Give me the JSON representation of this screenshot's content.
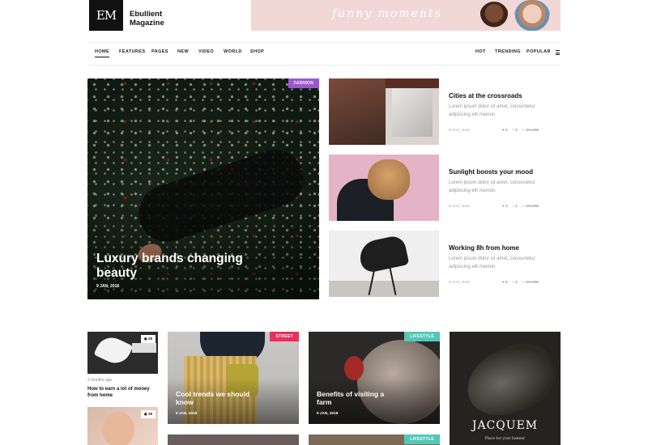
{
  "logo": {
    "mark": "EM",
    "line1": "Ebullient",
    "line2": "Magazine"
  },
  "banner": {
    "text": "funny moments"
  },
  "nav": {
    "left": [
      "HOME",
      "FEATURES",
      "PAGES",
      "NEW",
      "VIDEO",
      "WORLD",
      "SHOP"
    ],
    "right": [
      "HOT",
      "TRENDING",
      "POPULAR"
    ],
    "menu_icon": "hamburger-icon"
  },
  "hero": {
    "tag": "FASHION",
    "title": "Luxury brands changing beauty",
    "date": "9 JAN, 2018"
  },
  "side": [
    {
      "title": "Cities at the crossroads",
      "excerpt": "Lorem ipsum dolor sit amet, consectetur adipiscing elit meinon.",
      "date": "9 JAN, 2018",
      "likes": "0",
      "comments": "3",
      "share": "SHARE"
    },
    {
      "title": "Sunlight boosts your mood",
      "excerpt": "Lorem ipsum dolor sit amet, consectetur adipiscing elit meinon.",
      "date": "8 JAN, 2018",
      "likes": "3",
      "comments": "3",
      "share": "SHARE"
    },
    {
      "title": "Working 8h from home",
      "excerpt": "Lorem ipsum dolor sit amet, consectetur adipiscing elit meinon.",
      "date": "9 JAN, 2018",
      "likes": "5",
      "comments": "3",
      "share": "SHARE"
    }
  ],
  "small_post": {
    "views": "28",
    "ago": "2 months ago",
    "title": "How to earn a lot of money from home",
    "views2": "38"
  },
  "cards": [
    {
      "tag": "STREET",
      "title": "Cool trends we should know",
      "date": "9 JAN, 2018"
    },
    {
      "tag": "LIFESTYLE",
      "title": "Benefits of visiting a farm",
      "date": "9 JAN, 2018"
    }
  ],
  "ad": {
    "brand": "JACQUEM",
    "sub": "Place for your banner"
  },
  "tag_bottom": "LIFESTYLE",
  "colors": {
    "fashion": "#9b59d0",
    "street": "#e8305a",
    "lifestyle": "#52c8b8"
  }
}
